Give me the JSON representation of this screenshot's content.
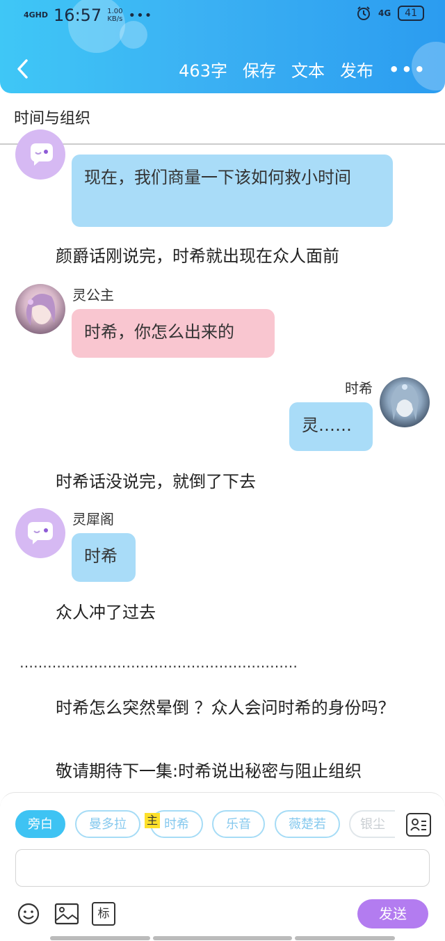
{
  "status_bar": {
    "network": "4GHD",
    "time": "16:57",
    "speed_value": "1.00",
    "speed_unit": "KB/s",
    "more": "•••",
    "signal": "4G",
    "battery": "41"
  },
  "nav": {
    "word_count": "463字",
    "save": "保存",
    "text": "文本",
    "publish": "发布",
    "more": "•••"
  },
  "story_title": "时间与组织",
  "chat": [
    {
      "type": "message",
      "speaker": "",
      "text": "现在，我们商量一下该如何救小时间",
      "side": "left",
      "color": "blue"
    },
    {
      "type": "narration",
      "text": "颜爵话刚说完，时希就出现在众人面前"
    },
    {
      "type": "message",
      "speaker": "灵公主",
      "text": "时希，你怎么出来的",
      "side": "left",
      "color": "pink"
    },
    {
      "type": "message",
      "speaker": "时希",
      "text": "灵……",
      "side": "right",
      "color": "blue"
    },
    {
      "type": "narration",
      "text": "时希话没说完，就倒了下去"
    },
    {
      "type": "message",
      "speaker": "灵犀阁",
      "text": "时希",
      "side": "left",
      "color": "blue"
    },
    {
      "type": "narration",
      "text": "众人冲了过去"
    },
    {
      "type": "separator",
      "text": "……………………………………………………"
    },
    {
      "type": "narration",
      "text": "时希怎么突然晕倒 ？众人会问时希的身份吗？"
    },
    {
      "type": "narration",
      "text": "敬请期待下一集:时希说出秘密与阻止组织"
    }
  ],
  "roles": [
    {
      "label": "旁白",
      "active": true
    },
    {
      "label": "曼多拉",
      "active": false
    },
    {
      "label": "时希",
      "active": false,
      "tag": "主"
    },
    {
      "label": "乐音",
      "active": false
    },
    {
      "label": "薇楚若",
      "active": false
    },
    {
      "label": "银尘",
      "active": false
    }
  ],
  "input": {
    "value": "",
    "placeholder": ""
  },
  "toolbar": {
    "emoji_icon": "smile-icon",
    "image_icon": "image-icon",
    "mark_label": "标",
    "send_label": "发送"
  },
  "colors": {
    "accent": "#3ec3f3",
    "send": "#b37cf0",
    "bubble_blue": "#a9dcf8",
    "bubble_pink": "#f9c6d0",
    "avatar_purple": "#d6b9f3"
  }
}
